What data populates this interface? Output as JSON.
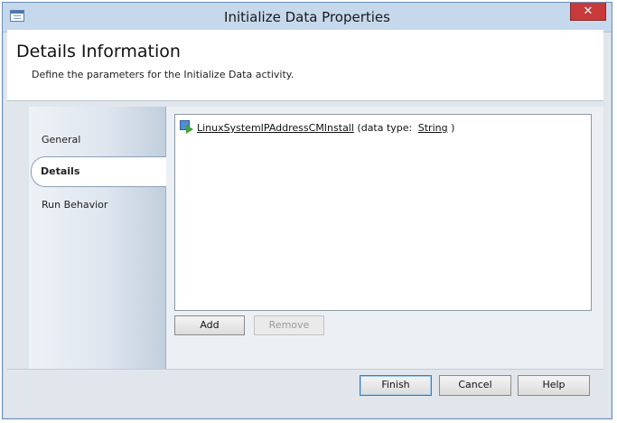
{
  "window": {
    "title": "Initialize Data Properties",
    "close_label": "✕"
  },
  "header": {
    "title": "Details Information",
    "subtitle": "Define the parameters for the Initialize Data activity."
  },
  "sidebar": {
    "items": [
      {
        "label": "General",
        "selected": false
      },
      {
        "label": "Details",
        "selected": true
      },
      {
        "label": "Run Behavior",
        "selected": false
      }
    ]
  },
  "details": {
    "parameters": [
      {
        "name": "LinuxSystemIPAddressCMInstall",
        "prefix": "(data type:",
        "type": "String",
        "suffix": ")"
      }
    ],
    "add_label": "Add",
    "remove_label": "Remove"
  },
  "footer": {
    "finish_label": "Finish",
    "cancel_label": "Cancel",
    "help_label": "Help"
  }
}
